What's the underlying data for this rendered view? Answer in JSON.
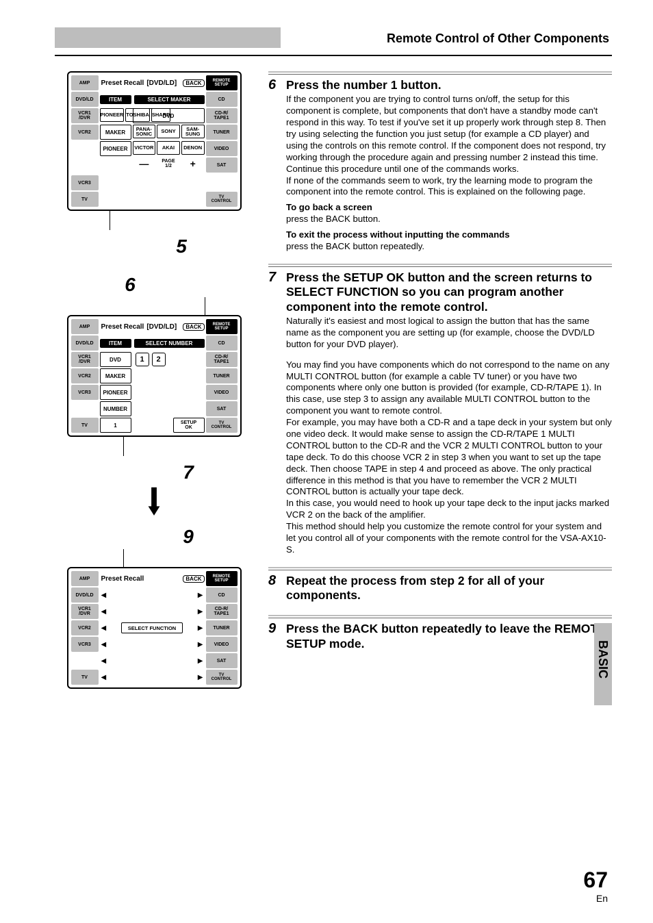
{
  "header": {
    "title": "Remote Control of Other Components"
  },
  "sideTab": "BASIC",
  "pageNumber": "67",
  "pageLang": "En",
  "lcd_common": {
    "preset_recall": "Preset Recall",
    "back": "BACK",
    "remote_setup": "REMOTE SETUP",
    "left_labels": [
      "AMP",
      "DVD/LD",
      "VCR1\n/DVR",
      "VCR2",
      "VCR3",
      "TV"
    ],
    "right_labels": [
      "CD",
      "CD-R/\nTAPE1",
      "TUNER",
      "VIDEO",
      "SAT",
      "TV\nCONTROL"
    ]
  },
  "lcd1": {
    "bracket_device": "[DVD/LD]",
    "item_label": "ITEM",
    "select_maker": "SELECT MAKER",
    "items": [
      "DVD",
      "MAKER",
      "PIONEER"
    ],
    "makers_r1": [
      "PIONEER",
      "TOSHIBA",
      "SHARP"
    ],
    "makers_r2": [
      "PANA-\nSONIC",
      "SONY",
      "SAM-\nSUNG"
    ],
    "makers_r3": [
      "VICTOR",
      "AKAI",
      "DENON"
    ],
    "bottom": [
      "—",
      "PAGE\n1/2",
      "+"
    ],
    "callout": "5"
  },
  "lcd2": {
    "bracket_device": "[DVD/LD]",
    "item_label": "ITEM",
    "select_number": "SELECT NUMBER",
    "items": [
      "DVD",
      "MAKER",
      "PIONEER",
      "NUMBER",
      "1"
    ],
    "num_buttons": [
      "1",
      "2"
    ],
    "setup_ok": "SETUP\nOK",
    "callout_top": "6",
    "callout_bottom": "7"
  },
  "lcd3": {
    "select_function": "SELECT FUNCTION",
    "callout": "9"
  },
  "steps": {
    "s6": {
      "num": "6",
      "head": "Press the number 1 button.",
      "p1": "If the component you are trying to control turns on/off, the setup for this component is complete, but components that don't have a standby mode can't respond in this way. To test if you've set it up properly work through step 8. Then try using selecting the function you just setup (for example a CD player) and using the controls on this remote control. If the component does not respond, try working through the procedure again and pressing number 2 instead this time. Continue this procedure until one of the commands works.",
      "p2": "If none of the commands seem to work, try the learning mode to program the component into the remote control. This is explained on the following page.",
      "sub1_head": "To go back a screen",
      "sub1_body": "press the BACK button.",
      "sub2_head": "To exit the process without inputting the commands",
      "sub2_body": "press the BACK button repeatedly."
    },
    "s7": {
      "num": "7",
      "head": "Press the SETUP OK button and the screen returns to SELECT FUNCTION so you can program another component into the remote control.",
      "p1": "Naturally it's easiest and most logical to assign the button that has the same name as the component you are setting up (for example, choose the DVD/LD button for your DVD player).",
      "p2": "You may find you have components which do not correspond to the name on any MULTI CONTROL button (for example a cable TV tuner) or you have two components where only one button is provided (for example, CD-R/TAPE 1). In this case, use step 3 to assign any available MULTI CONTROL button to the component you want to remote control.",
      "p3": "For example, you may have both a CD-R and a tape deck in your system but only one video deck. It would make sense to assign the CD-R/TAPE 1 MULTI CONTROL button to the CD-R and the VCR 2 MULTI CONTROL button to your tape deck. To do this choose VCR 2 in step 3 when you want to set up the tape deck. Then choose TAPE in step 4 and proceed as above. The only practical difference in this method is that you have to remember the VCR 2 MULTI CONTROL button is actually your tape deck.",
      "p4": "In this case, you would need to hook up your tape deck to the input jacks marked VCR 2 on the back of the amplifier.",
      "p5": "This method should help you customize the remote control for your system and let you control all of your components with the remote control for the VSA-AX10-S."
    },
    "s8": {
      "num": "8",
      "head": "Repeat the process from step 2 for all of your components."
    },
    "s9": {
      "num": "9",
      "head": "Press the BACK button repeatedly to leave the REMOTE SETUP mode."
    }
  }
}
